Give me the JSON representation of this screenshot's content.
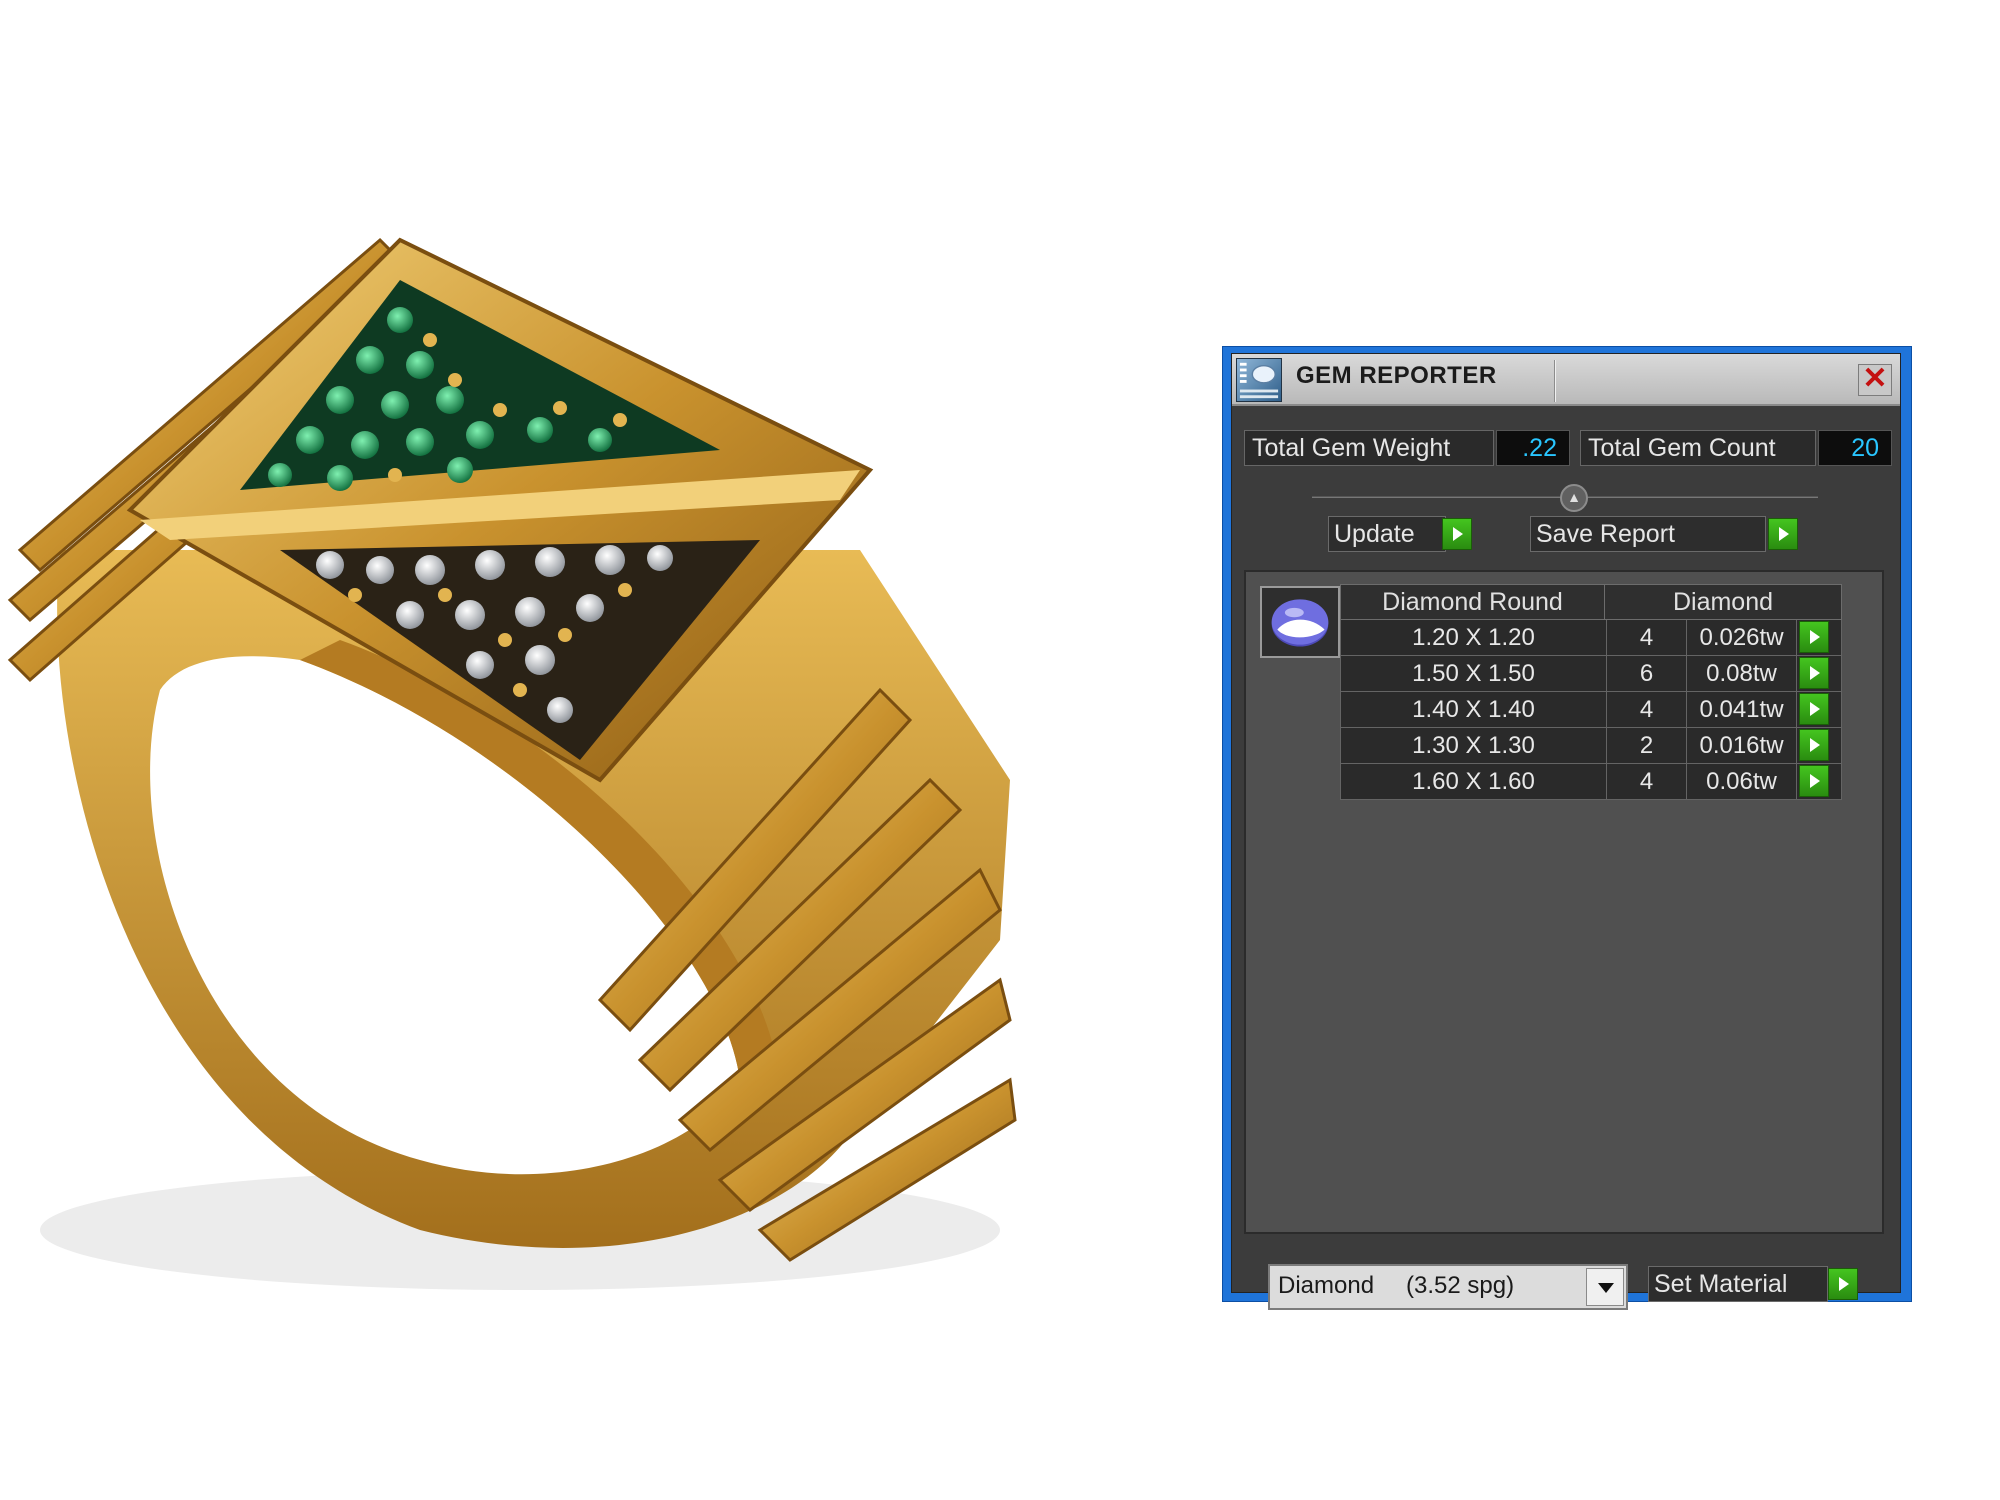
{
  "window": {
    "title": "GEM REPORTER",
    "close_symbol": "✕"
  },
  "totals": {
    "weight_label": "Total Gem Weight",
    "weight_value": ".22",
    "count_label": "Total Gem Count",
    "count_value": "20"
  },
  "buttons": {
    "update_label": "Update",
    "save_report_label": "Save Report",
    "set_material_label": "Set Material"
  },
  "table": {
    "headers": [
      "Diamond Round",
      "Diamond"
    ],
    "rows": [
      {
        "size": "1.20 X 1.20",
        "count": "4",
        "weight": "0.026tw"
      },
      {
        "size": "1.50 X 1.50",
        "count": "6",
        "weight": "0.08tw"
      },
      {
        "size": "1.40 X 1.40",
        "count": "4",
        "weight": "0.041tw"
      },
      {
        "size": "1.30 X 1.30",
        "count": "2",
        "weight": "0.016tw"
      },
      {
        "size": "1.60 X 1.60",
        "count": "4",
        "weight": "0.06tw"
      }
    ]
  },
  "material": {
    "selected_name": "Diamond",
    "selected_spg": "(3.52 spg)"
  },
  "icons": {
    "app": "gem-reporter-app-icon",
    "gem": "round-gem-icon",
    "go": "green-play-icon"
  },
  "colors": {
    "window_frame": "#1f74d9",
    "panel_bg": "#3c3c3c",
    "value_text": "#29c6ff",
    "go_button": "#3aa81a",
    "ring_gold": "#d9a53f",
    "emerald": "#1f9a5a"
  }
}
